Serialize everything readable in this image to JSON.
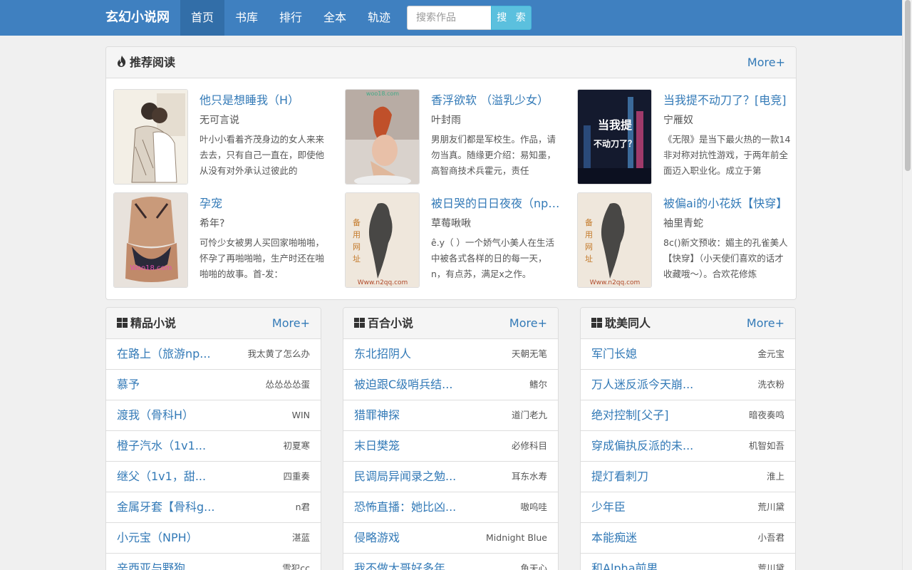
{
  "nav": {
    "brand": "玄幻小说网",
    "items": [
      {
        "label": "首页",
        "active": true
      },
      {
        "label": "书库"
      },
      {
        "label": "排行"
      },
      {
        "label": "全本"
      },
      {
        "label": "轨迹"
      }
    ],
    "search_placeholder": "搜索作品",
    "search_button": "搜 索"
  },
  "recommend": {
    "title": "推荐阅读",
    "more": "More+",
    "books": [
      {
        "title": "他只是想睡我（H）",
        "author": "无可言说",
        "desc": "叶小小看着齐茂身边的女人来来去去，只有自己一直在，即使他从没有对外承认过彼此的",
        "cover_text": ""
      },
      {
        "title": "香浮欲软 （溢乳少女）",
        "author": "叶封雨",
        "desc": "男朋友们都是军校生。作品，请勿当真。随缘更介绍：易知墨，高智商技术兵霍元，责任",
        "cover_text": "woo18.com"
      },
      {
        "title": "当我提不动刀了？[电竞]",
        "author": "宁雁奴",
        "desc": "《无限》是当下最火热的一款14非对称对抗性游戏，于两年前全面迈入职业化。成立于第",
        "cover_text": "不动刀了？当我提"
      },
      {
        "title": "孕宠",
        "author": "希年?",
        "desc": "可怜少女被男人买回家啪啪啪，怀孕了再啪啪啪，生产时还在啪啪啪的故事。首-发：",
        "cover_text": "Woo18.com"
      },
      {
        "title": "被日哭的日日夜夜（np高H）",
        "author": "草莓啾啾",
        "desc": "ê.y（ ）一个娇气小美人在生活中被各式各样的日的每一天，n，有点苏，满足x之作。",
        "cover_text": "Www.n2qq.com"
      },
      {
        "title": "被偏ai的小花妖【快穿】",
        "author": "袖里青蛇",
        "desc": "8c()新文预收：媚主的孔雀美人【快穿】（小天使们喜欢的话才收藏哦～）。合欢花修炼",
        "cover_text": "Www.n2qq.com"
      }
    ]
  },
  "sections": [
    {
      "title": "精品小说",
      "more": "More+",
      "rows": [
        {
          "title": "在路上（旅游np...",
          "author": "我太黄了怎么办"
        },
        {
          "title": "慕予",
          "author": "怂怂怂怂蛋"
        },
        {
          "title": "渡我（骨科H）",
          "author": "WIN"
        },
        {
          "title": "橙子汽水（1v1...",
          "author": "初夏寒"
        },
        {
          "title": "继父（1v1，甜...",
          "author": "四重奏"
        },
        {
          "title": "金属牙套【骨科g...",
          "author": "n君"
        },
        {
          "title": "小元宝（NPH）",
          "author": "湛蓝"
        },
        {
          "title": "辛西亚与野狗",
          "author": "雪犯cc"
        }
      ]
    },
    {
      "title": "百合小说",
      "more": "More+",
      "rows": [
        {
          "title": "东北招阴人",
          "author": "天朝无笔"
        },
        {
          "title": "被迫跟C级哨兵结...",
          "author": "鳍尔"
        },
        {
          "title": "猎罪神探",
          "author": "道门老九"
        },
        {
          "title": "末日樊笼",
          "author": "必修科目"
        },
        {
          "title": "民调局异闻录之勉...",
          "author": "耳东水寿"
        },
        {
          "title": "恐怖直播：她比凶...",
          "author": "嗷呜哇"
        },
        {
          "title": "侵略游戏",
          "author": "Midnight Blue"
        },
        {
          "title": "我不做大哥好多年",
          "author": "鱼天心"
        }
      ]
    },
    {
      "title": "耽美同人",
      "more": "More+",
      "rows": [
        {
          "title": "军门长媳",
          "author": "金元宝"
        },
        {
          "title": "万人迷反派今天崩...",
          "author": "洗衣粉"
        },
        {
          "title": "绝对控制[父子]",
          "author": "暗夜奏鸣"
        },
        {
          "title": "穿成偏执反派的未...",
          "author": "机智如吾"
        },
        {
          "title": "提灯看刺刀",
          "author": "淮上"
        },
        {
          "title": "少年臣",
          "author": "荒川黛"
        },
        {
          "title": "本能痴迷",
          "author": "小吾君"
        },
        {
          "title": "和Alpha前男",
          "author": "荒川黛"
        }
      ]
    }
  ]
}
